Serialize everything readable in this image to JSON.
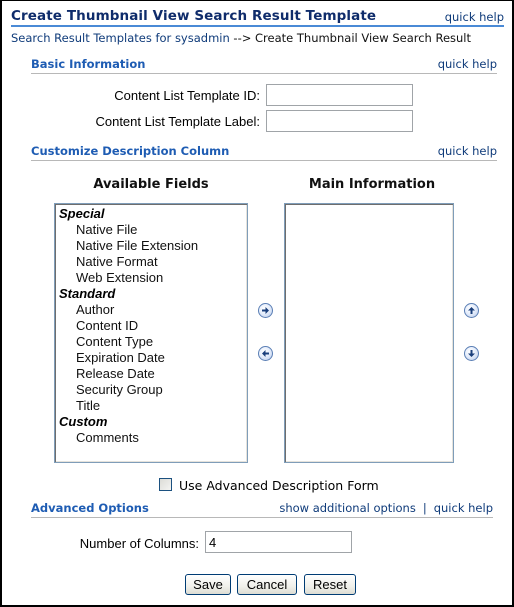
{
  "header": {
    "title": "Create Thumbnail View Search Result Template",
    "quick_help": "quick help"
  },
  "breadcrumb": {
    "parent": "Search Result Templates for sysadmin",
    "separator": " --> ",
    "current": "Create Thumbnail View Search Result"
  },
  "basic_information": {
    "title": "Basic Information",
    "quick_help": "quick help",
    "fields": [
      {
        "label": "Content List Template ID:",
        "value": "",
        "placeholder": ""
      },
      {
        "label": "Content List Template Label:",
        "value": "",
        "placeholder": ""
      }
    ]
  },
  "customize_description": {
    "title": "Customize Description Column",
    "quick_help": "quick help",
    "available_fields": {
      "title": "Available Fields",
      "groups": [
        {
          "name": "Special",
          "items": [
            "Native File",
            "Native File Extension",
            "Native Format",
            "Web Extension"
          ]
        },
        {
          "name": "Standard",
          "items": [
            "Author",
            "Content ID",
            "Content Type",
            "Expiration Date",
            "Release Date",
            "Security Group",
            "Title"
          ]
        },
        {
          "name": "Custom",
          "items": [
            "Comments"
          ]
        }
      ]
    },
    "main_information": {
      "title": "Main Information",
      "items": []
    },
    "buttons": {
      "add": "arrow-right-icon",
      "remove": "arrow-left-icon",
      "move_up": "arrow-up-icon",
      "move_down": "arrow-down-icon"
    },
    "advanced_form_checkbox": {
      "label": "Use Advanced Description Form",
      "checked": false
    }
  },
  "advanced_options": {
    "title": "Advanced Options",
    "show_additional": "show additional options",
    "separator": "|",
    "quick_help": "quick help",
    "columns_label": "Number of Columns:",
    "columns_value": "4"
  },
  "actions": {
    "save": "Save",
    "cancel": "Cancel",
    "reset": "Reset"
  },
  "colors": {
    "title": "#0f2c6b",
    "section_title": "#1e5cb3",
    "link": "#0f3b7a",
    "title_rule": "#4a8ad6"
  }
}
